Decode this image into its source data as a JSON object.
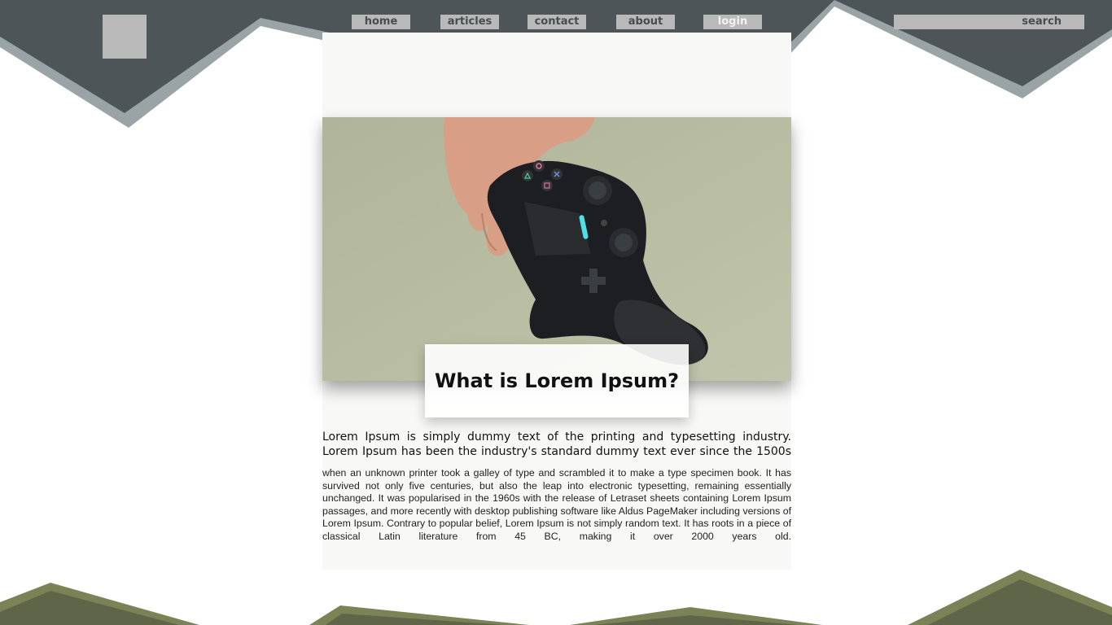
{
  "nav": {
    "items": [
      {
        "label": "home"
      },
      {
        "label": "articles"
      },
      {
        "label": "contact"
      },
      {
        "label": "about"
      },
      {
        "label": "login"
      }
    ]
  },
  "search": {
    "label": "search",
    "placeholder": ""
  },
  "article": {
    "title": "What is Lorem Ipsum?",
    "intro": "Lorem Ipsum is simply dummy text of the printing and typesetting industry. Lorem Ipsum has been the industry's standard dummy text ever since the 1500s",
    "body": "when an unknown printer took a galley of type and scrambled it to make a type specimen book. It has survived not only five centuries, but also the leap into electronic typesetting, remaining essentially unchanged. It was popularised in the 1960s with the release of Letraset sheets containing Lorem Ipsum passages, and more recently with desktop publishing software like Aldus PageMaker including versions of Lorem Ipsum. Contrary to popular belief, Lorem Ipsum is not simply random text. It has roots in a piece of classical Latin literature from 45 BC, making it over 2000 years old."
  },
  "colors": {
    "header": "#4d5559",
    "header_accent": "#9aa4a6",
    "footer": "#5f6548",
    "footer_accent": "#7a8256",
    "hero_bg": "#b7bba0",
    "nav_button": "#b9b9b9"
  },
  "icons": {
    "logo": "logo-placeholder",
    "hero": "game-controller-in-hand"
  }
}
